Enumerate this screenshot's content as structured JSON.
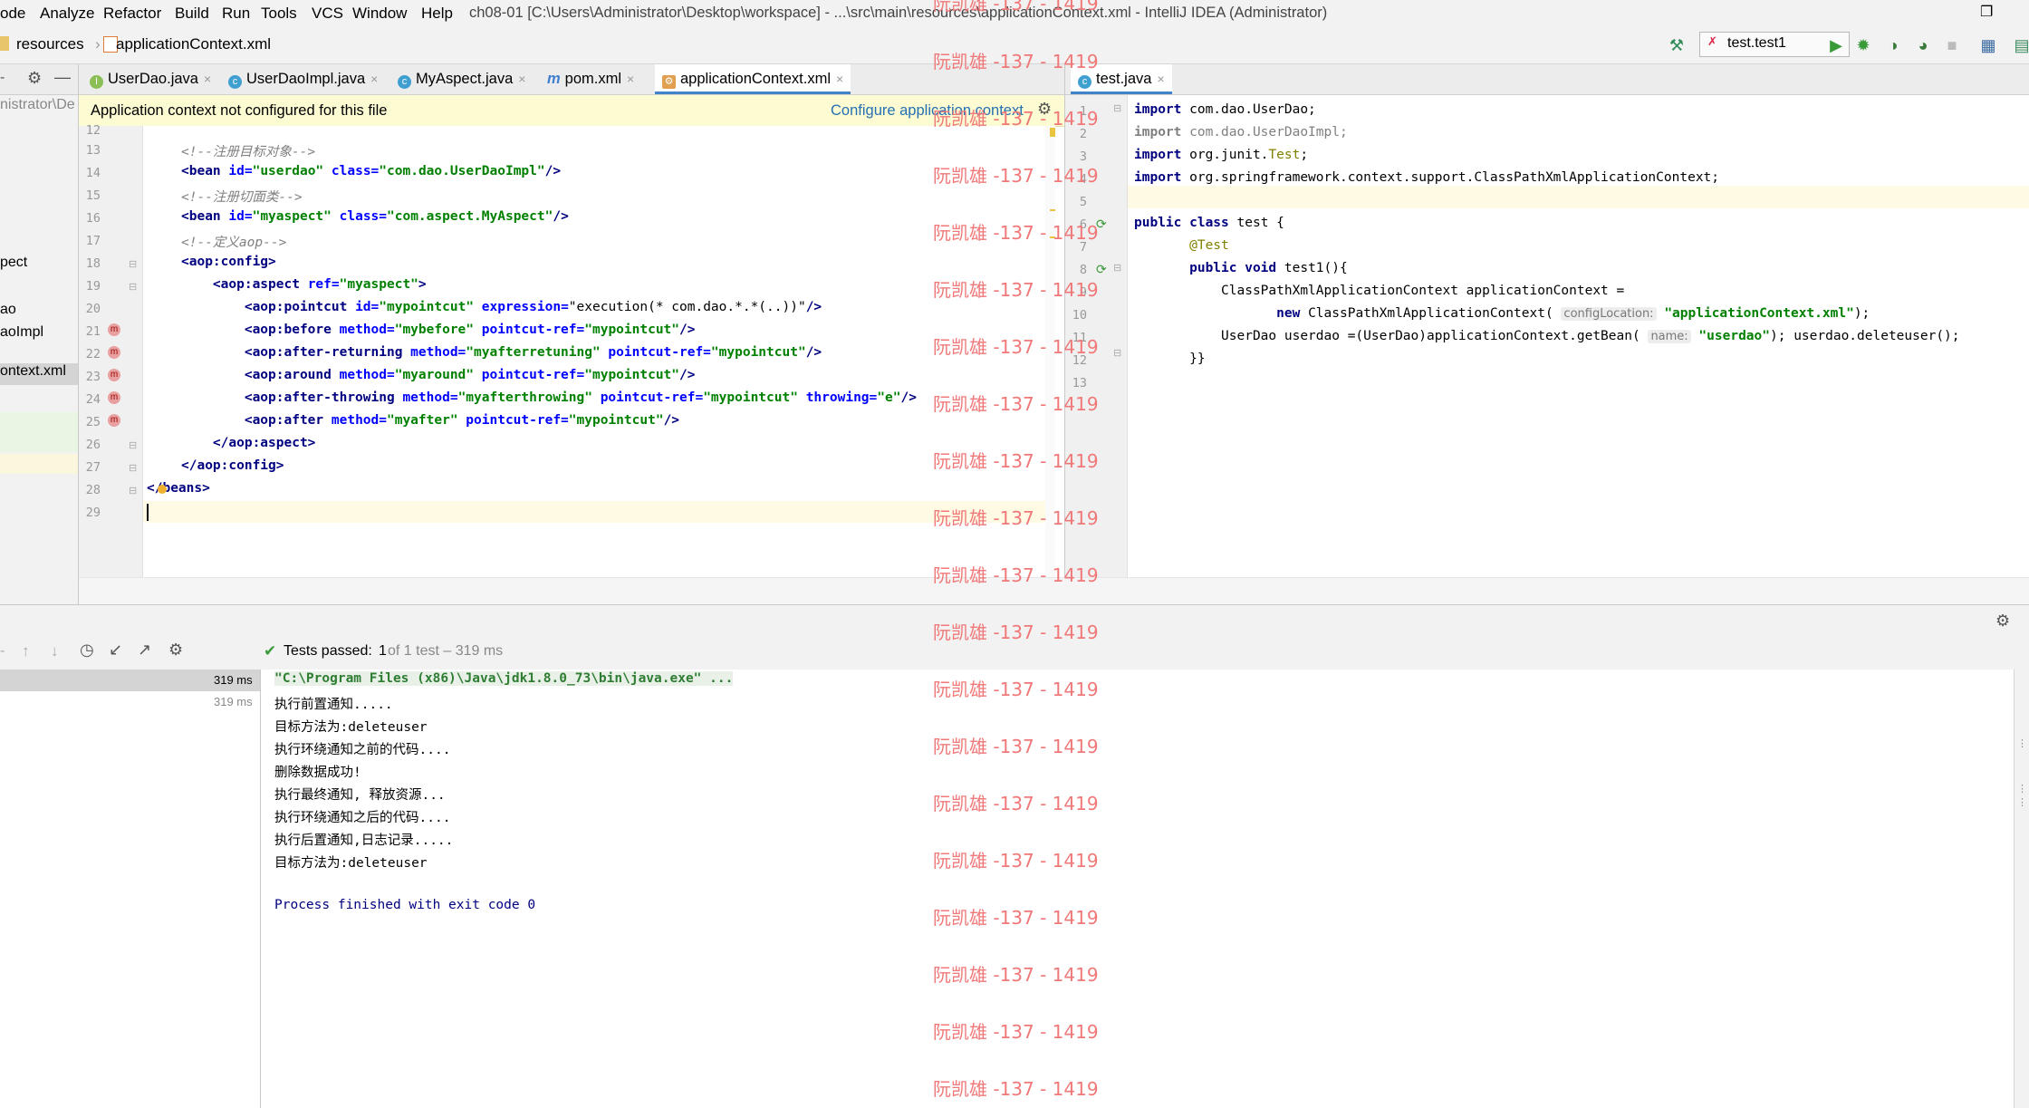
{
  "menubar": {
    "items": [
      "ode",
      "Analyze",
      "Refactor",
      "Build",
      "Run",
      "Tools",
      "VCS",
      "Window",
      "Help"
    ],
    "title": "ch08-01 [C:\\Users\\Administrator\\Desktop\\workspace] - ...\\src\\main\\resources\\applicationContext.xml - IntelliJ IDEA (Administrator)"
  },
  "navbar": {
    "crumb1": "resources",
    "crumb2": "applicationContext.xml",
    "run_config": "test.test1"
  },
  "project": {
    "header_text": "nistrator\\De",
    "items": [
      "pect",
      "ao",
      "aoImpl",
      "ontext.xml"
    ]
  },
  "tabs_left": [
    "UserDao.java",
    "UserDaoImpl.java",
    "MyAspect.java",
    "pom.xml",
    "applicationContext.xml"
  ],
  "tabs_right": [
    "test.java"
  ],
  "banner": {
    "message": "Application context not configured for this file",
    "action": "Configure application context"
  },
  "xml_editor": {
    "line_numbers": [
      "12",
      "13",
      "14",
      "15",
      "16",
      "17",
      "18",
      "19",
      "20",
      "21",
      "22",
      "23",
      "24",
      "25",
      "26",
      "27",
      "28",
      "29"
    ],
    "lines": [
      "",
      "<!--注册目标对象-->",
      "<bean id=\"userdao\" class=\"com.dao.UserDaoImpl\"/>",
      "<!--注册切面类-->",
      "<bean id=\"myaspect\" class=\"com.aspect.MyAspect\"/>",
      "<!--定义aop-->",
      "<aop:config>",
      "    <aop:aspect ref=\"myaspect\">",
      "        <aop:pointcut id=\"mypointcut\" expression=\"execution(* com.dao.*.*(..))\"/>",
      "        <aop:before method=\"mybefore\" pointcut-ref=\"mypointcut\"/>",
      "        <aop:after-returning method=\"myafterretuning\" pointcut-ref=\"mypointcut\"/>",
      "        <aop:around method=\"myaround\" pointcut-ref=\"mypointcut\"/>",
      "        <aop:after-throwing method=\"myafterthrowing\" pointcut-ref=\"mypointcut\" throwing=\"e\"/>",
      "        <aop:after method=\"myafter\" pointcut-ref=\"mypointcut\"/>",
      "    </aop:aspect>",
      "</aop:config>",
      "</beans>",
      ""
    ]
  },
  "java_editor": {
    "line_numbers": [
      "1",
      "2",
      "3",
      "4",
      "5",
      "6",
      "7",
      "8",
      "9",
      "10",
      "11",
      "12",
      "13"
    ],
    "lines": [
      "import com.dao.UserDao;",
      "import com.dao.UserDaoImpl;",
      "import org.junit.Test;",
      "import org.springframework.context.support.ClassPathXmlApplicationContext;",
      "",
      "public class test {",
      "    @Test",
      "    public void test1(){",
      "        ClassPathXmlApplicationContext applicationContext =",
      "                new ClassPathXmlApplicationContext( configLocation: \"applicationContext.xml\");",
      "        UserDao userdao =(UserDao)applicationContext.getBean( name: \"userdao\"); userdao.deleteuser();",
      "    }}",
      ""
    ]
  },
  "run_panel": {
    "status_label": "Tests passed:",
    "status_count": "1",
    "status_detail": "of 1 test – 319 ms",
    "tree_times": [
      "319 ms",
      "319 ms"
    ],
    "console_lines": [
      "\"C:\\Program Files (x86)\\Java\\jdk1.8.0_73\\bin\\java.exe\" ...",
      "执行前置通知.....",
      "目标方法为:deleteuser",
      "执行环绕通知之前的代码....",
      "删除数据成功!",
      "执行最终通知, 释放资源...",
      "执行环绕通知之后的代码....",
      "执行后置通知,日志记录.....",
      "目标方法为:deleteuser",
      "",
      "Process finished with exit code 0"
    ]
  },
  "watermark": {
    "text": "阮凯雄 -137 - 1419",
    "count": 19
  },
  "colors": {
    "accent": "#4083c9",
    "banner_bg": "#fdfbd2",
    "watermark": "#f07878",
    "pass_green": "#3d9a3d"
  }
}
